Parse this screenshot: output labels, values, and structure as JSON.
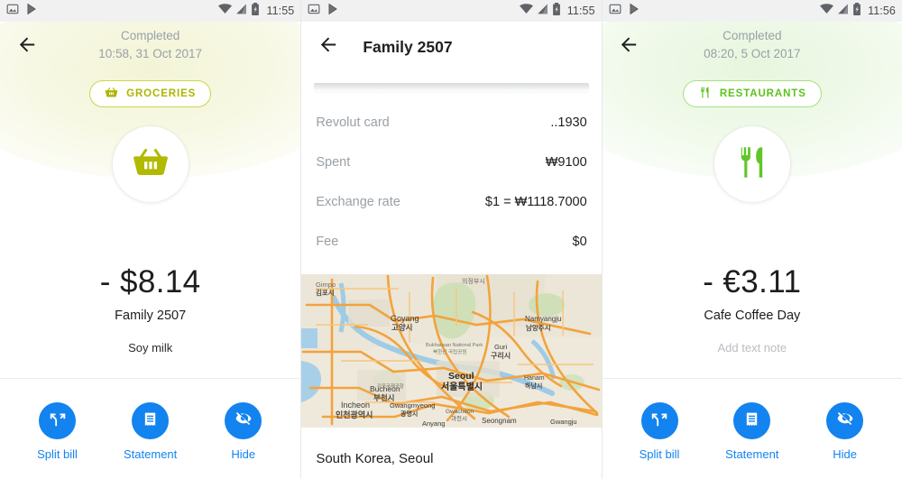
{
  "panels": [
    {
      "id": "groceries-transaction",
      "statusbar": {
        "time": "11:55",
        "left_icons": [
          "screenshot-icon",
          "play-store-icon"
        ],
        "right_icons": [
          "wifi-icon",
          "signal-icon",
          "battery-charging-icon"
        ]
      },
      "toolbar": {
        "back_label": "back-arrow",
        "status": "Completed",
        "date": "10:58, 31 Oct 2017"
      },
      "category": {
        "label": "GROCERIES",
        "icon": "shopping-basket-icon",
        "color": "#adb500",
        "border_color": "#cdd34d"
      },
      "avatar_icon": "shopping-basket-icon",
      "amount": "- $8.14",
      "merchant": "Family 2507",
      "note": "Soy milk",
      "note_is_placeholder": false,
      "actions": [
        {
          "label": "Split bill",
          "icon": "split-arrows-icon"
        },
        {
          "label": "Statement",
          "icon": "document-icon"
        },
        {
          "label": "Hide",
          "icon": "eye-off-icon"
        }
      ]
    },
    {
      "id": "transaction-details",
      "statusbar": {
        "time": "11:55",
        "left_icons": [
          "screenshot-icon",
          "play-store-icon"
        ],
        "right_icons": [
          "wifi-icon",
          "signal-icon",
          "battery-charging-icon"
        ]
      },
      "toolbar": {
        "back_label": "back-arrow",
        "title": "Family 2507"
      },
      "details": [
        {
          "label": "Revolut card",
          "value": "..1930"
        },
        {
          "label": "Spent",
          "value": "₩9100"
        },
        {
          "label": "Exchange rate",
          "value": "$1 = ₩1118.7000"
        },
        {
          "label": "Fee",
          "value": "$0"
        }
      ],
      "map": {
        "caption": "South Korea, Seoul",
        "labels": [
          {
            "en": "Gimpo",
            "ko": "김포시"
          },
          {
            "en": "Goyang",
            "ko": "고양시"
          },
          {
            "en": "",
            "ko": "의정부시"
          },
          {
            "en": "Namyangju",
            "ko": "남양주시"
          },
          {
            "en": "Bukhansan National Park",
            "ko": "북한산 국립공원"
          },
          {
            "en": "Guri",
            "ko": "구리시"
          },
          {
            "en": "Seoul",
            "ko": "서울특별시"
          },
          {
            "en": "Hanam",
            "ko": "하남시"
          },
          {
            "en": "Bucheon",
            "ko": "부천시"
          },
          {
            "en": "Incheon",
            "ko": "인천광역시"
          },
          {
            "en": "Gwangmyeong",
            "ko": "광명시"
          },
          {
            "en": "Gwacheon",
            "ko": "과천시"
          },
          {
            "en": "Anyang",
            "ko": ""
          },
          {
            "en": "Seongnam",
            "ko": ""
          },
          {
            "en": "Gwangju",
            "ko": ""
          }
        ]
      }
    },
    {
      "id": "restaurants-transaction",
      "statusbar": {
        "time": "11:56",
        "left_icons": [
          "screenshot-icon",
          "play-store-icon"
        ],
        "right_icons": [
          "wifi-icon",
          "signal-icon",
          "battery-charging-icon"
        ]
      },
      "toolbar": {
        "back_label": "back-arrow",
        "status": "Completed",
        "date": "08:20, 5 Oct 2017"
      },
      "category": {
        "label": "RESTAURANTS",
        "icon": "fork-knife-icon",
        "color": "#5fc220",
        "border_color": "#a8df7e"
      },
      "avatar_icon": "fork-knife-icon",
      "amount": "- €3.11",
      "merchant": "Cafe Coffee Day",
      "note": "Add text note",
      "note_is_placeholder": true,
      "actions": [
        {
          "label": "Split bill",
          "icon": "split-arrows-icon"
        },
        {
          "label": "Statement",
          "icon": "document-icon"
        },
        {
          "label": "Hide",
          "icon": "eye-off-icon"
        }
      ]
    }
  ],
  "colors": {
    "action_blue": "#1283ef",
    "groceries_olive": "#adb500",
    "restaurants_green": "#5fc220",
    "muted_text": "#9aa0a6",
    "statusbar_bg": "#f1f1f1"
  }
}
